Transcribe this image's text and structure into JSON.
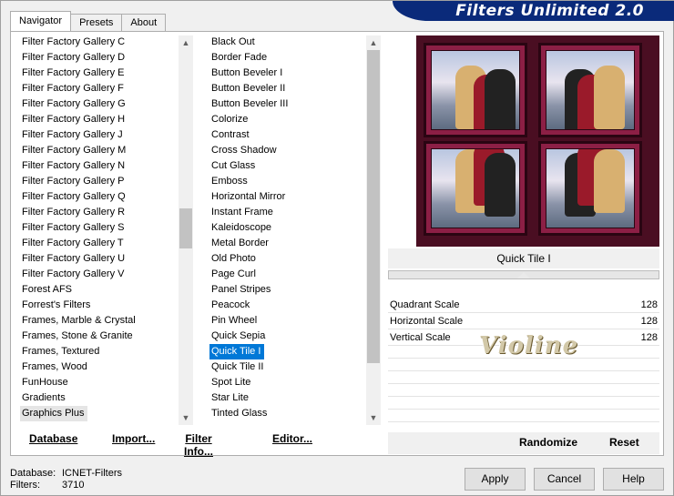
{
  "banner": {
    "title": "Filters Unlimited 2.0"
  },
  "tabs": [
    {
      "label": "Navigator"
    },
    {
      "label": "Presets"
    },
    {
      "label": "About"
    }
  ],
  "categories": [
    "Filter Factory Gallery C",
    "Filter Factory Gallery D",
    "Filter Factory Gallery E",
    "Filter Factory Gallery F",
    "Filter Factory Gallery G",
    "Filter Factory Gallery H",
    "Filter Factory Gallery J",
    "Filter Factory Gallery M",
    "Filter Factory Gallery N",
    "Filter Factory Gallery P",
    "Filter Factory Gallery Q",
    "Filter Factory Gallery R",
    "Filter Factory Gallery S",
    "Filter Factory Gallery T",
    "Filter Factory Gallery U",
    "Filter Factory Gallery V",
    "Forest AFS",
    "Forrest's Filters",
    "Frames, Marble & Crystal",
    "Frames, Stone & Granite",
    "Frames, Textured",
    "Frames, Wood",
    "FunHouse",
    "Gradients",
    "Graphics Plus"
  ],
  "category_highlighted": "Graphics Plus",
  "filters": [
    "Black Out",
    "Border Fade",
    "Button Beveler I",
    "Button Beveler II",
    "Button Beveler III",
    "Colorize",
    "Contrast",
    "Cross Shadow",
    "Cut Glass",
    "Emboss",
    "Horizontal Mirror",
    "Instant Frame",
    "Kaleidoscope",
    "Metal Border",
    "Old Photo",
    "Page Curl",
    "Panel Stripes",
    "Peacock",
    "Pin Wheel",
    "Quick Sepia",
    "Quick Tile I",
    "Quick Tile II",
    "Spot Lite",
    "Star Lite",
    "Tinted Glass"
  ],
  "filter_selected": "Quick Tile I",
  "left_buttons": {
    "database": "Database",
    "import": "Import...",
    "filter_info": "Filter Info...",
    "editor": "Editor..."
  },
  "preview": {
    "filter_name": "Quick Tile I"
  },
  "params": [
    {
      "name": "Quadrant Scale",
      "value": "128"
    },
    {
      "name": "Horizontal Scale",
      "value": "128"
    },
    {
      "name": "Vertical Scale",
      "value": "128"
    }
  ],
  "watermark": "Violine",
  "right_buttons": {
    "randomize": "Randomize",
    "reset": "Reset"
  },
  "info": {
    "database_label": "Database:",
    "database_value": "ICNET-Filters",
    "filters_label": "Filters:",
    "filters_value": "3710"
  },
  "footer_buttons": {
    "apply": "Apply",
    "cancel": "Cancel",
    "help": "Help"
  },
  "colors": {
    "selection": "#0078d7",
    "banner": "#0a2a7a"
  }
}
